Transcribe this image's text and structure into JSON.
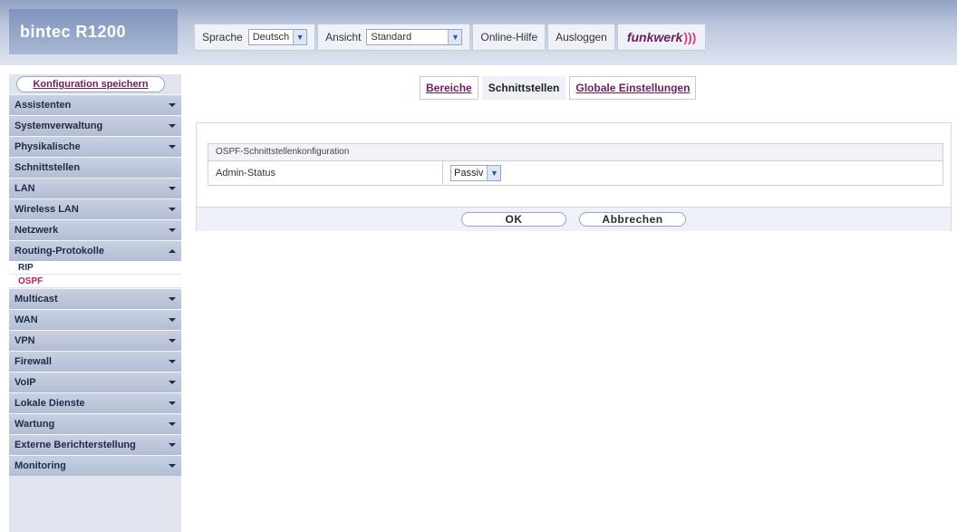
{
  "header": {
    "brand": "bintec R1200",
    "language_label": "Sprache",
    "language_value": "Deutsch",
    "view_label": "Ansicht",
    "view_value": "Standard",
    "online_help": "Online-Hilfe",
    "logout": "Ausloggen",
    "logo": "funkwerk",
    "logo_mark": ")))"
  },
  "sidebar": {
    "save_button": "Konfiguration speichern",
    "items": [
      {
        "label": "Assistenten",
        "chevron": "down"
      },
      {
        "label": "Systemverwaltung",
        "chevron": "down"
      },
      {
        "label": "Physikalische",
        "chevron": "down"
      },
      {
        "label": "Schnittstellen",
        "chevron": ""
      },
      {
        "label": "LAN",
        "chevron": "down"
      },
      {
        "label": "Wireless LAN",
        "chevron": "down"
      },
      {
        "label": "Netzwerk",
        "chevron": "down"
      },
      {
        "label": "Routing-Protokolle",
        "chevron": "up"
      },
      {
        "label": "Multicast",
        "chevron": "down"
      },
      {
        "label": "WAN",
        "chevron": "down"
      },
      {
        "label": "VPN",
        "chevron": "down"
      },
      {
        "label": "Firewall",
        "chevron": "down"
      },
      {
        "label": "VoIP",
        "chevron": "down"
      },
      {
        "label": "Lokale Dienste",
        "chevron": "down"
      },
      {
        "label": "Wartung",
        "chevron": "down"
      },
      {
        "label": "Externe Berichterstellung",
        "chevron": "down"
      },
      {
        "label": "Monitoring",
        "chevron": "down"
      }
    ],
    "subitems": [
      {
        "label": "RIP",
        "active": false
      },
      {
        "label": "OSPF",
        "active": true
      }
    ]
  },
  "tabs": [
    {
      "label": "Bereiche",
      "current": false
    },
    {
      "label": "Schnittstellen",
      "current": true
    },
    {
      "label": "Globale Einstellungen",
      "current": false
    }
  ],
  "form": {
    "section_title": "OSPF-Schnittstellenkonfiguration",
    "admin_status_label": "Admin-Status",
    "admin_status_value": "Passiv"
  },
  "buttons": {
    "ok": "OK",
    "cancel": "Abbrechen"
  },
  "colors": {
    "link": "#6b1e5c",
    "active": "#b02463",
    "nav_bg": "#b4bfd5"
  }
}
